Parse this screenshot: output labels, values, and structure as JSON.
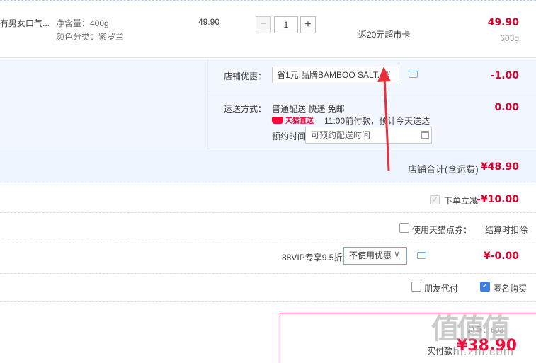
{
  "item": {
    "title": "有男女口气...",
    "spec_net": "净含量：400g",
    "spec_color": "颜色分类：紫罗兰",
    "unit_price": "49.90",
    "qty_minus": "−",
    "qty_value": "1",
    "qty_plus": "+",
    "promo": "返20元超市卡",
    "total": "49.90",
    "weight": "603g"
  },
  "shop_discount": {
    "label": "店铺优惠：",
    "selected": "省1元:品牌BAMBOO SALT...",
    "caret": "∨",
    "amount": "-1.00"
  },
  "shipping": {
    "label": "运送方式：",
    "method": "普通配送 快递 免邮",
    "badge": "天猫直送",
    "time_note": "11:00前付款，预计今天送达",
    "reserve_label": "预约时间",
    "reserve_placeholder": "可预约配送时间",
    "amount": "0.00"
  },
  "shop_total": {
    "label": "店铺合计(含运费)",
    "value": "¥48.90"
  },
  "instant_discount": {
    "check": "✓",
    "label": "下单立减",
    "amount": "-¥10.00"
  },
  "tmall_points": {
    "label": "使用天猫点券：",
    "value": "结算时扣除"
  },
  "vip": {
    "label": "88VIP专享9.5折",
    "selected": "不使用优惠",
    "caret": "∨",
    "amount": "¥-0.00"
  },
  "options": {
    "friend_pay": "朋友代付",
    "anonymous_check": "✓",
    "anonymous": "匿名购买"
  },
  "pay": {
    "weight": "总重：603",
    "label": "实付款：",
    "amount": "¥38.90"
  },
  "watermark": {
    "logo": "值值值",
    "url": "zhi.zhi.com"
  },
  "colors": {
    "accent_red": "#ff0036",
    "panel_blue": "#f2f7ff",
    "checkbox_blue": "#3d7fe0"
  }
}
